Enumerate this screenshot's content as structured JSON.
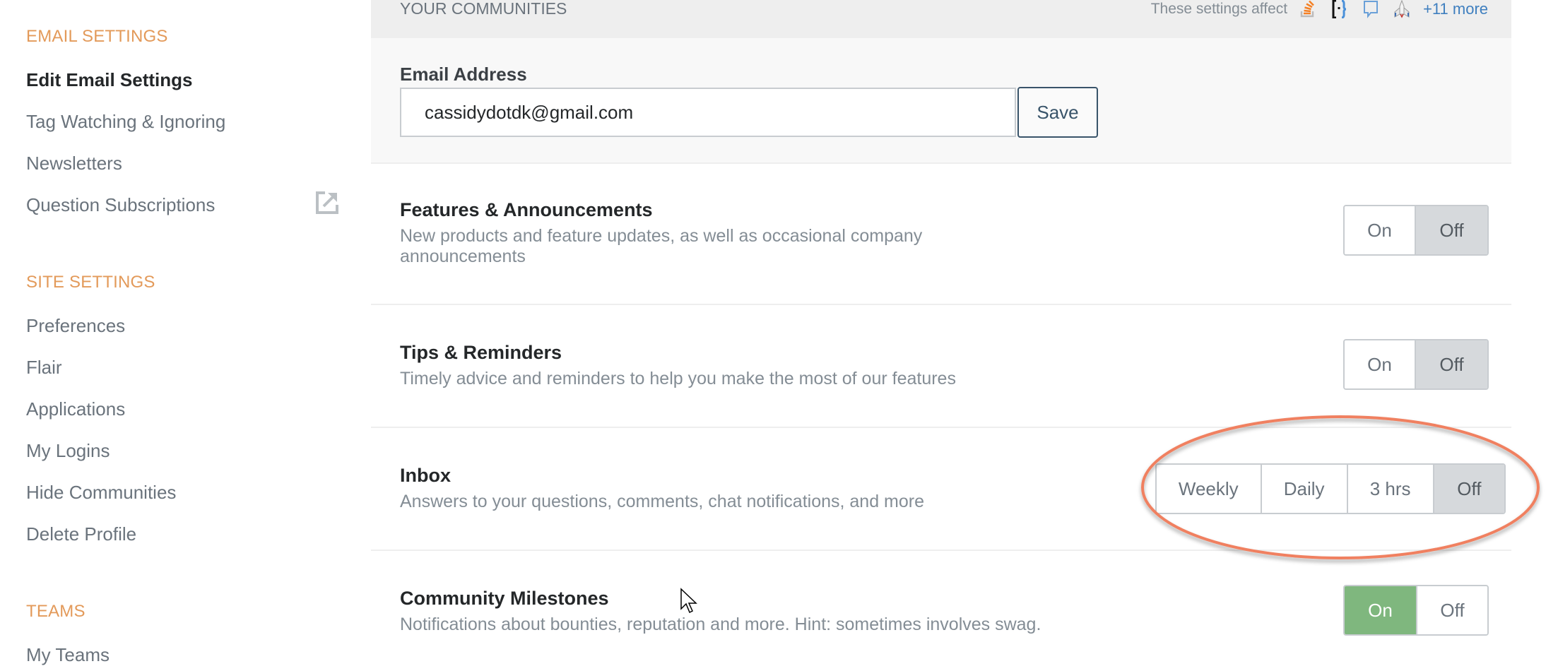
{
  "sidebar": {
    "sections": [
      {
        "heading": "EMAIL SETTINGS",
        "items": [
          "Edit Email Settings",
          "Tag Watching & Ignoring",
          "Newsletters",
          "Question Subscriptions"
        ]
      },
      {
        "heading": "SITE SETTINGS",
        "items": [
          "Preferences",
          "Flair",
          "Applications",
          "My Logins",
          "Hide Communities",
          "Delete Profile"
        ]
      },
      {
        "heading": "TEAMS",
        "items": [
          "My Teams"
        ]
      }
    ],
    "active_item": "Edit Email Settings",
    "external_link_icon": "external-link-icon"
  },
  "header": {
    "title": "YOUR COMMUNITIES",
    "affect_label": "These settings affect",
    "site_icons": [
      "stack-overflow-icon",
      "meta-brackets-icon",
      "chat-bubble-icon",
      "rocket-ship-icon"
    ],
    "more_link": "+11 more"
  },
  "email": {
    "label": "Email Address",
    "value": "cassidydotdk@gmail.com",
    "save_label": "Save"
  },
  "settings": [
    {
      "title": "Features & Announcements",
      "description": "New products and feature updates, as well as occasional company announcements",
      "options": [
        "On",
        "Off"
      ],
      "selected": "Off"
    },
    {
      "title": "Tips & Reminders",
      "description": "Timely advice and reminders to help you make the most of our features",
      "options": [
        "On",
        "Off"
      ],
      "selected": "Off"
    },
    {
      "title": "Inbox",
      "description": "Answers to your questions, comments, chat notifications, and more",
      "options": [
        "Weekly",
        "Daily",
        "3 hrs",
        "Off"
      ],
      "selected": "Off"
    },
    {
      "title": "Community Milestones",
      "description": "Notifications about bounties, reputation and more. Hint: sometimes involves swag.",
      "options": [
        "On",
        "Off"
      ],
      "selected": "On"
    }
  ],
  "colors": {
    "section_heading": "#e39a5a",
    "on_selected": "#7fb77e",
    "off_selected": "#d6d9dc",
    "annotation": "#f08060",
    "link": "#3f7fbf"
  },
  "annotation": {
    "shape": "ellipse",
    "target": "Inbox frequency selector"
  }
}
